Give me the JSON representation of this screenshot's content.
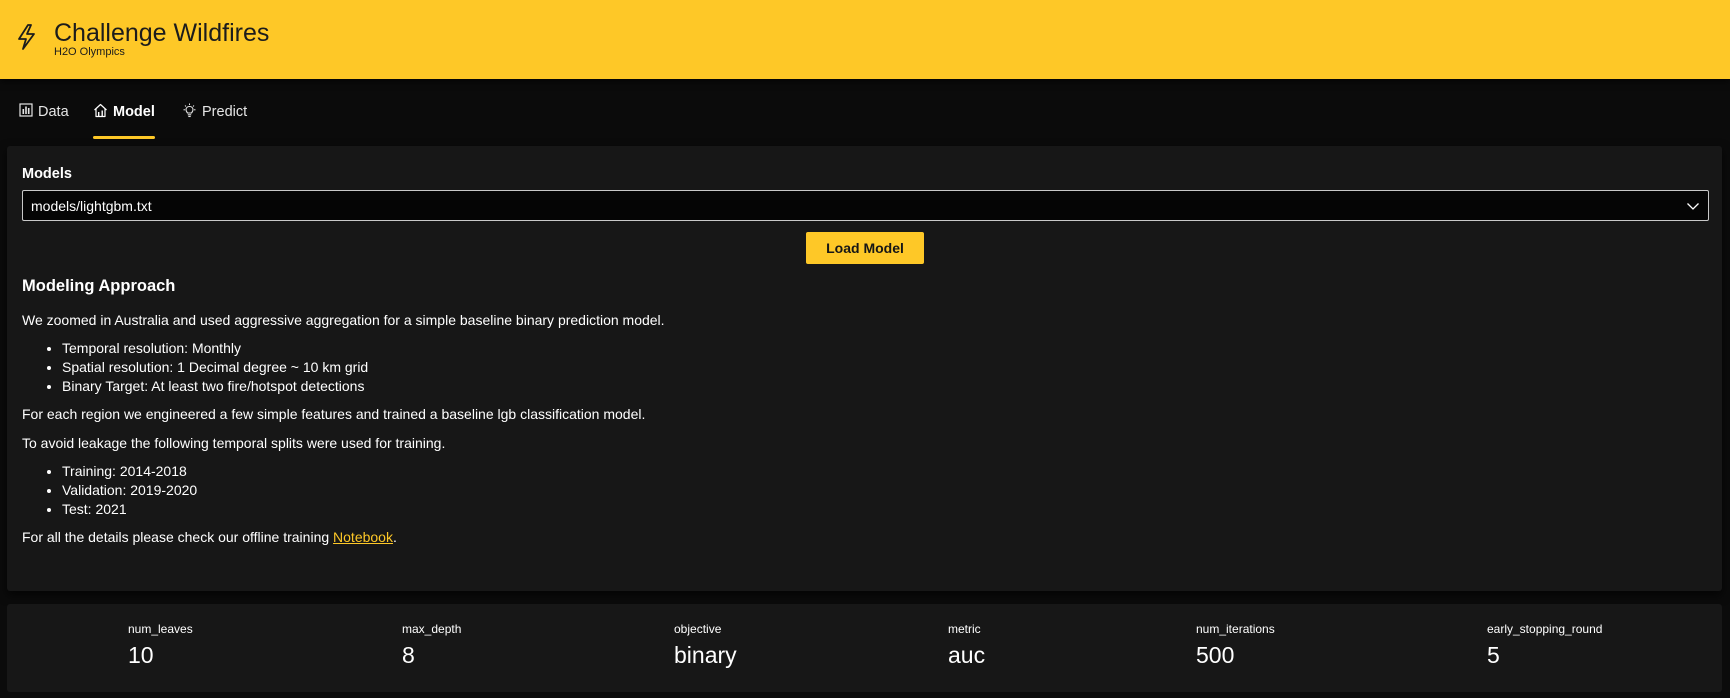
{
  "header": {
    "title": "Challenge Wildfires",
    "subtitle": "H2O Olympics",
    "logo_icon": "lightning-bolt-icon",
    "background_color": "#fec827"
  },
  "tabs": [
    {
      "label": "Data",
      "icon": "bar-chart-icon",
      "active": false
    },
    {
      "label": "Model",
      "icon": "home-chart-icon",
      "active": true
    },
    {
      "label": "Predict",
      "icon": "lightbulb-icon",
      "active": false
    }
  ],
  "models": {
    "label": "Models",
    "selected": "models/lightgbm.txt",
    "load_button": "Load Model"
  },
  "approach": {
    "heading": "Modeling Approach",
    "intro": "We zoomed in Australia and used aggressive aggregation for a simple baseline binary prediction model.",
    "resolution_items": [
      "Temporal resolution: Monthly",
      "Spatial resolution: 1 Decimal degree ~ 10 km grid",
      "Binary Target: At least two fire/hotspot detections"
    ],
    "features_text": "For each region we engineered a few simple features and trained a baseline lgb classification model.",
    "splits_text": "To avoid leakage the following temporal splits were used for training.",
    "split_items": [
      "Training: 2014-2018",
      "Validation: 2019-2020",
      "Test: 2021"
    ],
    "details_prefix": "For all the details please check our offline training ",
    "details_link": "Notebook",
    "details_suffix": "."
  },
  "params": [
    {
      "key": "num_leaves",
      "value": "10"
    },
    {
      "key": "max_depth",
      "value": "8"
    },
    {
      "key": "objective",
      "value": "binary"
    },
    {
      "key": "metric",
      "value": "auc"
    },
    {
      "key": "num_iterations",
      "value": "500"
    },
    {
      "key": "early_stopping_round",
      "value": "5"
    }
  ],
  "accent_color": "#fec827"
}
